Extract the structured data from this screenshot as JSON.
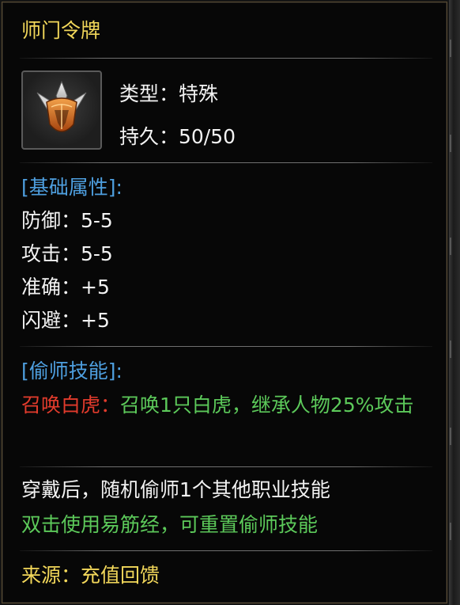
{
  "item": {
    "title": "师门令牌",
    "icon": "helmet-token-icon",
    "type_line": "类型：特殊",
    "durability_line": "持久：50/50"
  },
  "base_stats": {
    "header": "[基础属性]:",
    "lines": [
      "防御：5-5",
      "攻击：5-5",
      "准确：+5",
      "闪避：+5"
    ]
  },
  "skill": {
    "header": "[偷师技能]:",
    "name": "召唤白虎：",
    "desc": "召唤1只白虎，继承人物25%攻击"
  },
  "notes": {
    "line1": "穿戴后，随机偷师1个其他职业技能",
    "line2": "双击使用易筋经，可重置偷师技能"
  },
  "source": "来源：充值回馈",
  "colors": {
    "title": "#f2d75a",
    "section_header": "#4e9fdf",
    "skill_name": "#e23b2c",
    "skill_desc": "#5cc95a",
    "text": "#f2f2f2"
  }
}
